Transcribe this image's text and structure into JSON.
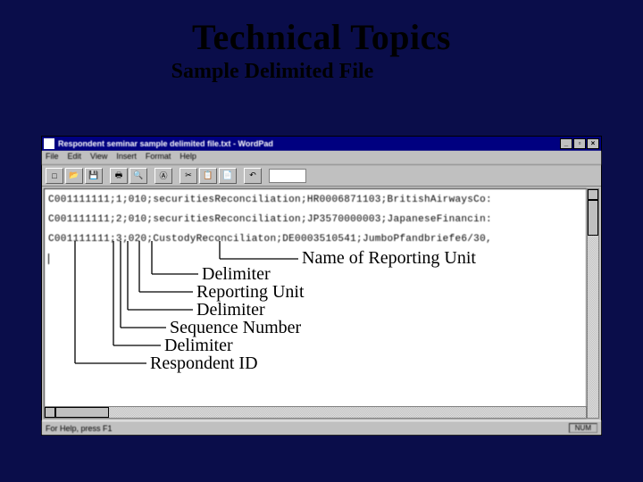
{
  "slide": {
    "title": "Technical Topics",
    "subtitle": "Sample Delimited File"
  },
  "window": {
    "title": "Respondent seminar sample delimited file.txt - WordPad",
    "menu": [
      "File",
      "Edit",
      "View",
      "Insert",
      "Format",
      "Help"
    ],
    "status_left": "For Help, press F1",
    "status_right": "NUM"
  },
  "lines": [
    "C001111111;1;010;securitiesReconciliation;HR0006871103;BritishAirwaysCo:",
    "C001111111;2;010;securitiesReconciliation;JP3570000003;JapaneseFinancin:",
    "C001111111;3;020;CustodyReconciliaton;DE0003510541;JumboPfandbriefe6/30,"
  ],
  "labels": {
    "a": "Name of Reporting Unit",
    "b": "Delimiter",
    "c": "Reporting Unit",
    "d": "Delimiter",
    "e": "Sequence Number",
    "f": "Delimiter",
    "g": "Respondent ID"
  }
}
